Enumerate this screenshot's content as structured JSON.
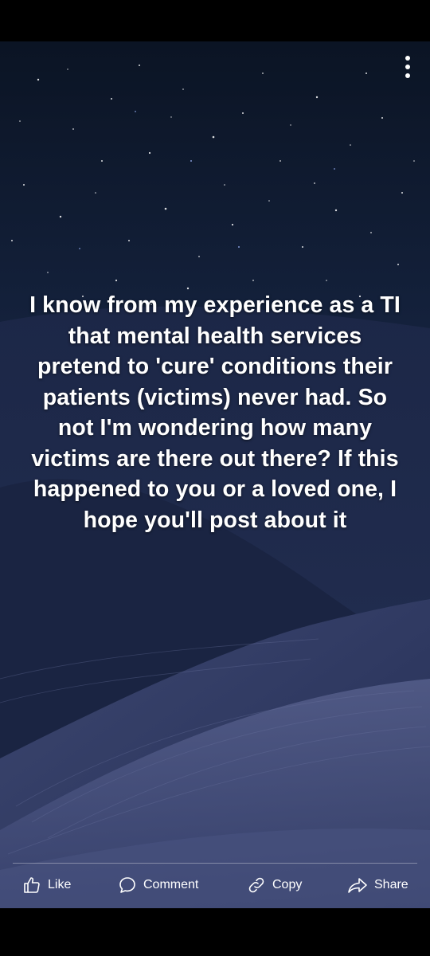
{
  "post": {
    "text": "I know from my experience as a TI that mental health services pretend to 'cure' conditions their patients (victims) never had. So not I'm wondering how many victims are there out there? If this happened to you or a loved one, I hope you'll post about it",
    "background_theme": "night sky over sand dunes",
    "text_color": "#ffffff"
  },
  "header": {
    "menu_icon": "more-vertical-icon"
  },
  "actions": {
    "like_label": "Like",
    "like_icon": "thumbs-up-icon",
    "comment_label": "Comment",
    "comment_icon": "speech-bubble-icon",
    "copy_label": "Copy",
    "copy_icon": "link-icon",
    "share_label": "Share",
    "share_icon": "share-arrow-icon"
  }
}
